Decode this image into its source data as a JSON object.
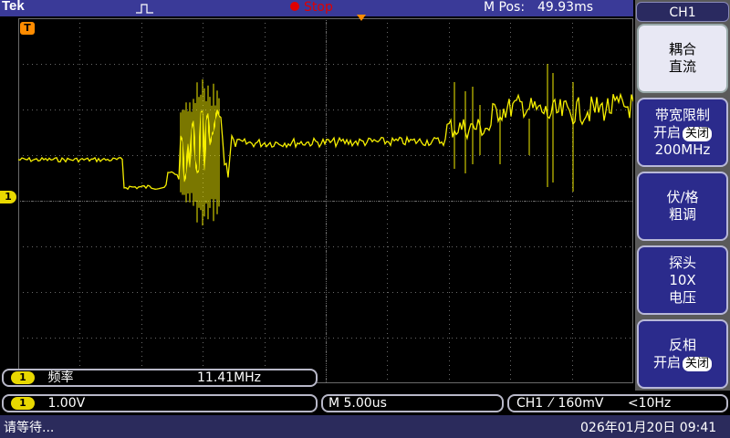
{
  "header": {
    "brand": "Tek",
    "run_state": "Stop",
    "mpos_label": "M Pos:",
    "mpos_value": "49.93ms"
  },
  "screen": {
    "channel_marker": "1",
    "trigger_marker": "T"
  },
  "menu": {
    "title": "CH1",
    "items": [
      {
        "line1": "耦合",
        "line2": "直流"
      },
      {
        "line1": "带宽限制",
        "line2_prefix": "开启",
        "tag": "关闭",
        "line3": "200MHz"
      },
      {
        "line1": "伏/格",
        "line2": "粗调"
      },
      {
        "line1": "探头",
        "line2": "10X",
        "line3": "电压"
      },
      {
        "line1": "反相",
        "line2_prefix": "开启",
        "tag": "关闭"
      }
    ]
  },
  "measure": {
    "channel": "1",
    "label": "频率",
    "value": "11.41MHz"
  },
  "settings": {
    "channel": "1",
    "volts_div": "1.00V",
    "timebase": "M 5.00us",
    "trigger_source": "CH1",
    "trigger_slope": "⁄",
    "trigger_level": "160mV",
    "trigger_freq": "<10Hz"
  },
  "status": {
    "message": "请等待...",
    "datetime": "026年01月20日 09:41"
  },
  "colors": {
    "trace": "#f5ee00",
    "accent": "#2b2b8c",
    "stop": "#e00000"
  }
}
